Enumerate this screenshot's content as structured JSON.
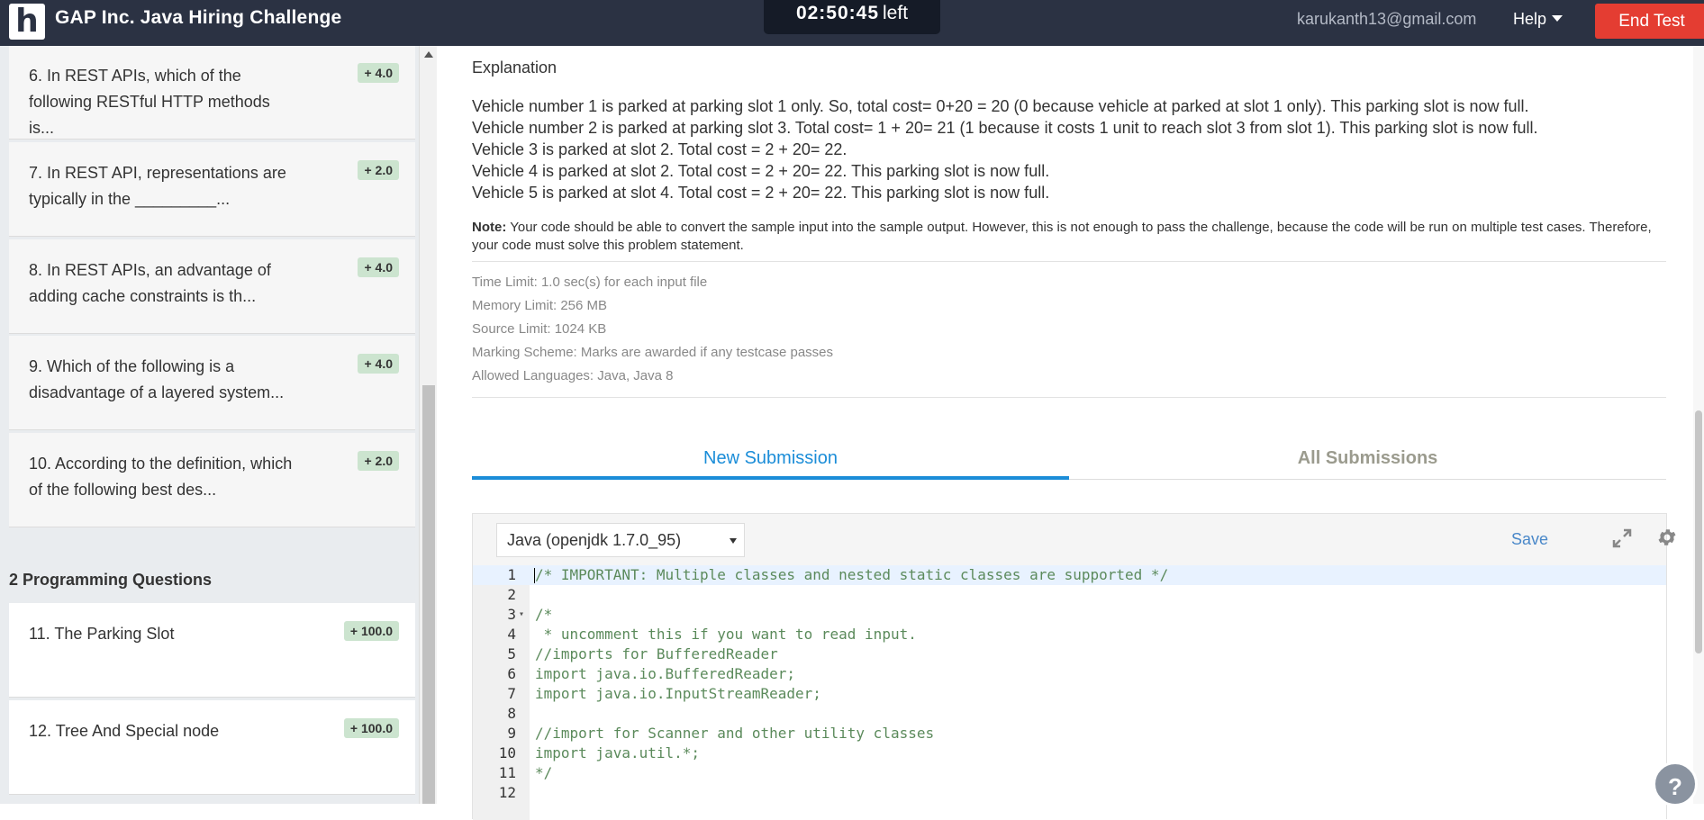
{
  "header": {
    "logo_letter": "h",
    "title": "GAP Inc. Java Hiring Challenge",
    "timer_value": "02:50:45",
    "timer_suffix": "left",
    "email": "karukanth13@gmail.com",
    "help_label": "Help",
    "end_test_label": "End Test"
  },
  "sidebar": {
    "questions": [
      {
        "num": "6.",
        "text": "In REST APIs, which of the following RESTful HTTP methods is...",
        "marks": "+ 4.0"
      },
      {
        "num": "7.",
        "text": "In REST API, representations are typically in the _________...",
        "marks": "+ 2.0"
      },
      {
        "num": "8.",
        "text": "In REST APIs, an advantage of adding cache constraints is th...",
        "marks": "+ 4.0"
      },
      {
        "num": "9.",
        "text": "Which of the following is a disadvantage of a layered system...",
        "marks": "+ 4.0"
      },
      {
        "num": "10.",
        "text": "According to the definition, which of the following best des...",
        "marks": "+ 2.0"
      }
    ],
    "section_title": "2 Programming Questions",
    "programming": [
      {
        "num": "11.",
        "text": "The Parking Slot",
        "marks": "+ 100.0"
      },
      {
        "num": "12.",
        "text": "Tree And Special node",
        "marks": "+ 100.0"
      }
    ]
  },
  "problem": {
    "explanation_heading": "Explanation",
    "explanation_lines": [
      "Vehicle number 1 is parked at parking slot 1 only. So, total cost= 0+20 = 20 (0 because vehicle at parked at slot 1 only). This parking slot is now full.",
      "Vehicle number 2 is parked at parking slot 3. Total cost= 1 + 20= 21 (1 because it costs 1 unit to reach slot 3 from slot 1). This parking slot is now full.",
      "Vehicle 3 is parked at slot 2. Total cost = 2 + 20= 22.",
      "Vehicle 4 is parked at slot 2. Total cost = 2 + 20= 22. This parking slot is now full.",
      "Vehicle 5 is parked at slot 4. Total cost = 2 + 20= 22. This parking slot is now full."
    ],
    "note_label": "Note:",
    "note_text": " Your code should be able to convert the sample input into the sample output. However, this is not enough to pass the challenge, because the code will be run on multiple test cases. Therefore, your code must solve this problem statement.",
    "limits": [
      "Time Limit: 1.0 sec(s) for each input file",
      "Memory Limit: 256 MB",
      "Source Limit: 1024 KB",
      "Marking Scheme: Marks are awarded if any testcase passes",
      "Allowed Languages: Java, Java 8"
    ]
  },
  "tabs": {
    "new_submission": "New Submission",
    "all_submissions": "All Submissions"
  },
  "editor": {
    "language": "Java (openjdk 1.7.0_95)",
    "save_label": "Save",
    "lines": [
      "/* IMPORTANT: Multiple classes and nested static classes are supported */",
      "",
      "/*",
      " * uncomment this if you want to read input.",
      "//imports for BufferedReader",
      "import java.io.BufferedReader;",
      "import java.io.InputStreamReader;",
      "",
      "//import for Scanner and other utility classes",
      "import java.util.*;",
      "*/",
      ""
    ],
    "line_numbers": [
      "1",
      "2",
      "3",
      "4",
      "5",
      "6",
      "7",
      "8",
      "9",
      "10",
      "11",
      "12"
    ]
  },
  "help_fab": "?"
}
